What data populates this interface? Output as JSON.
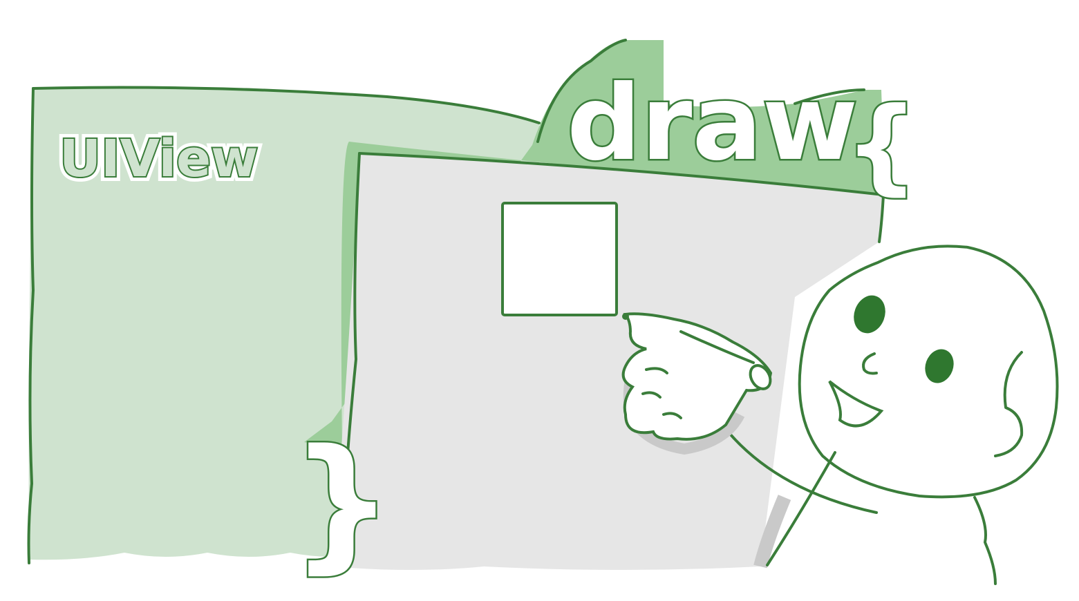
{
  "illustration": {
    "view_label": "UIView",
    "method_label": "draw",
    "open_brace": "{",
    "close_brace": "}"
  },
  "colors": {
    "ink": "#3a7d3a",
    "panel_green": "#cfe3cf",
    "flap_green": "#9ccd9a",
    "canvas_gray": "#e6e6e6",
    "shadow_gray": "#c9c9c9",
    "eye_green": "#2f772f",
    "white": "#ffffff"
  },
  "icons": [
    "uiview-panel",
    "draw-canvas",
    "white-rectangle",
    "stick-figure",
    "pointing-hand"
  ]
}
